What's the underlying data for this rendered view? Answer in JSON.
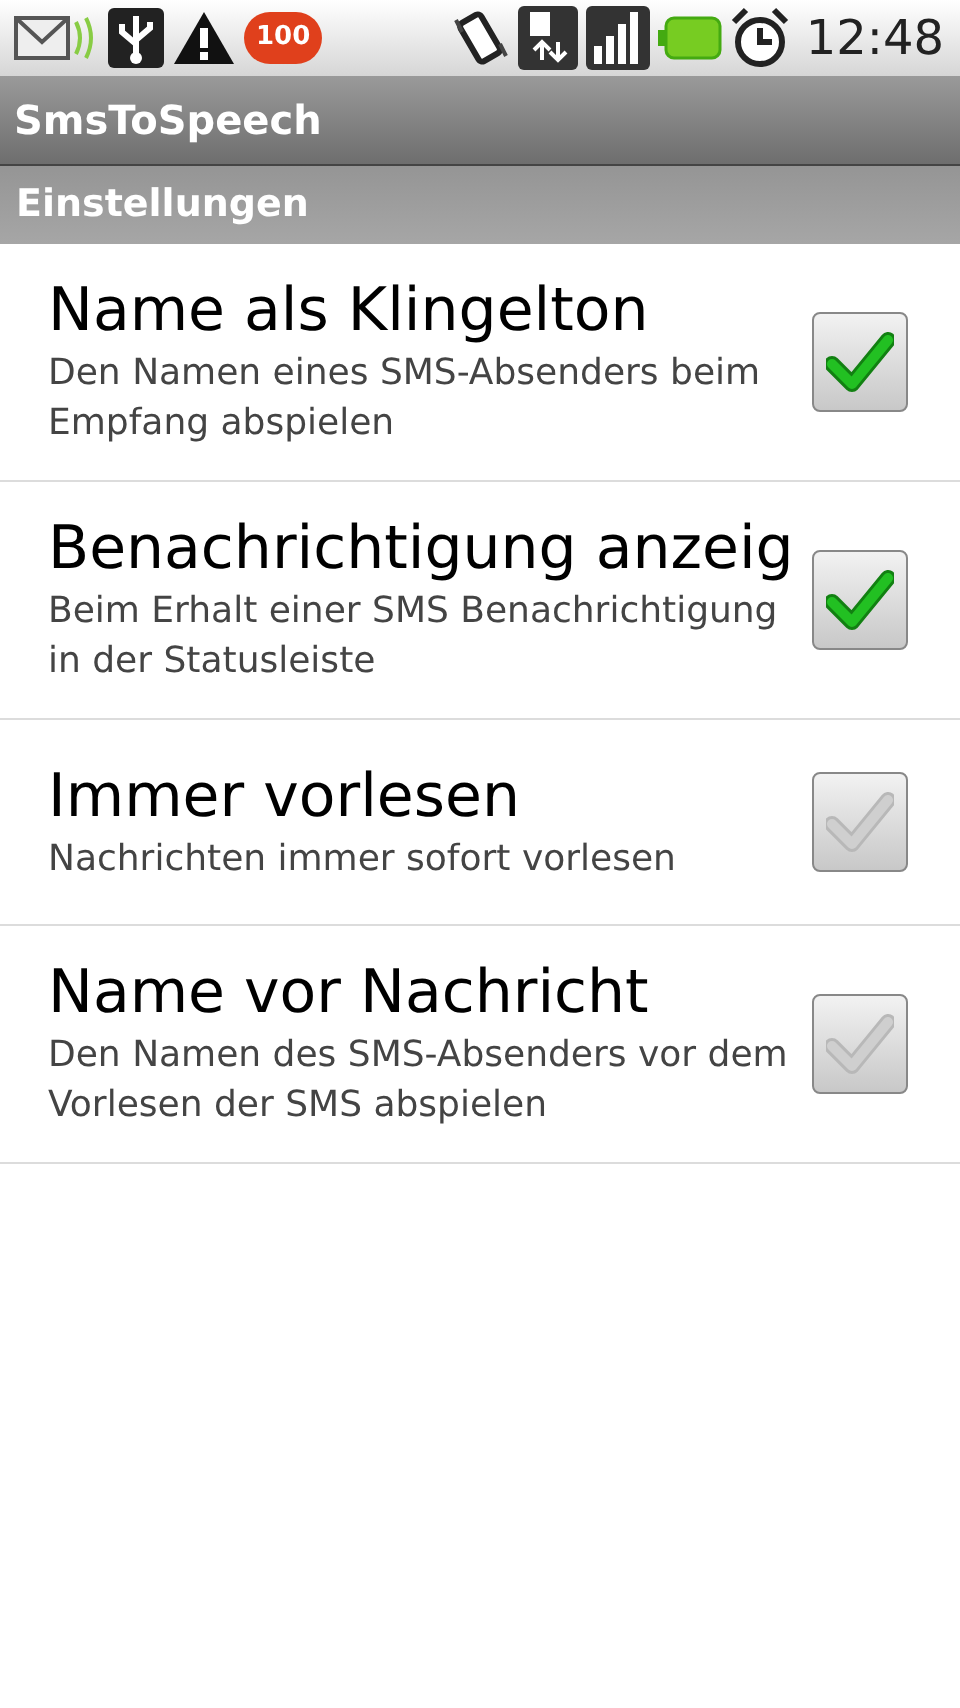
{
  "status_bar": {
    "battery_badge": "100",
    "time": "12:48"
  },
  "window": {
    "title": "SmsToSpeech"
  },
  "section": {
    "title": "Einstellungen"
  },
  "preferences": [
    {
      "title": "Name als Klingelton",
      "summary": "Den Namen eines SMS-Absenders beim Empfang abspielen",
      "checked": true
    },
    {
      "title": "Benachrichtigung anzeig",
      "summary": "Beim Erhalt einer SMS Benachrichtigung in der Statusleiste",
      "checked": true
    },
    {
      "title": "Immer vorlesen",
      "summary": "Nachrichten immer sofort vorlesen",
      "checked": false
    },
    {
      "title": "Name vor Nachricht",
      "summary": "Den Namen des SMS-Absenders vor dem Vorlesen der SMS abspielen",
      "checked": false
    }
  ]
}
